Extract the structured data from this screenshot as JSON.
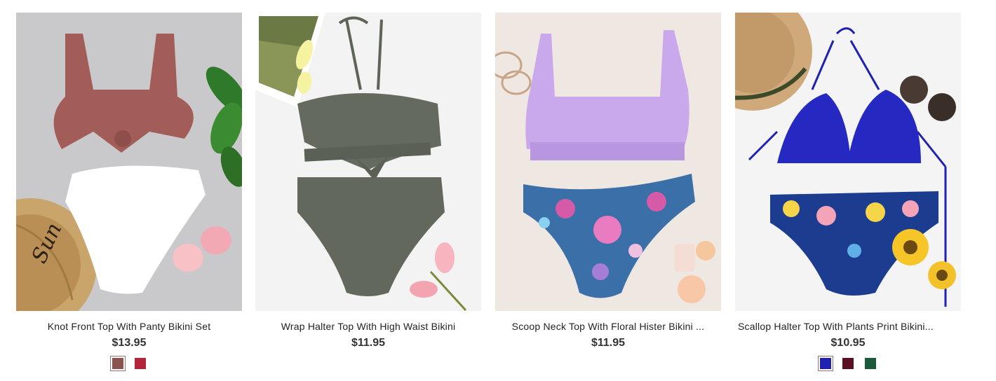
{
  "products": [
    {
      "title": "Knot Front Top With Panty Bikini Set",
      "price": "$13.95",
      "swatches": [
        {
          "color": "#8a5551",
          "selected": true
        },
        {
          "color": "#b3263a",
          "selected": false
        }
      ],
      "hat_text": "Sun"
    },
    {
      "title": "Wrap Halter Top With High Waist Bikini",
      "price": "$11.95",
      "swatches": []
    },
    {
      "title": "Scoop Neck Top With Floral Hister Bikini ...",
      "price": "$11.95",
      "swatches": []
    },
    {
      "title": "Scallop Halter Top With Plants Print Bikini...",
      "price": "$10.95",
      "swatches": [
        {
          "color": "#1f22b0",
          "selected": true
        },
        {
          "color": "#5a1020",
          "selected": false
        },
        {
          "color": "#1a5a3a",
          "selected": false
        }
      ]
    }
  ]
}
